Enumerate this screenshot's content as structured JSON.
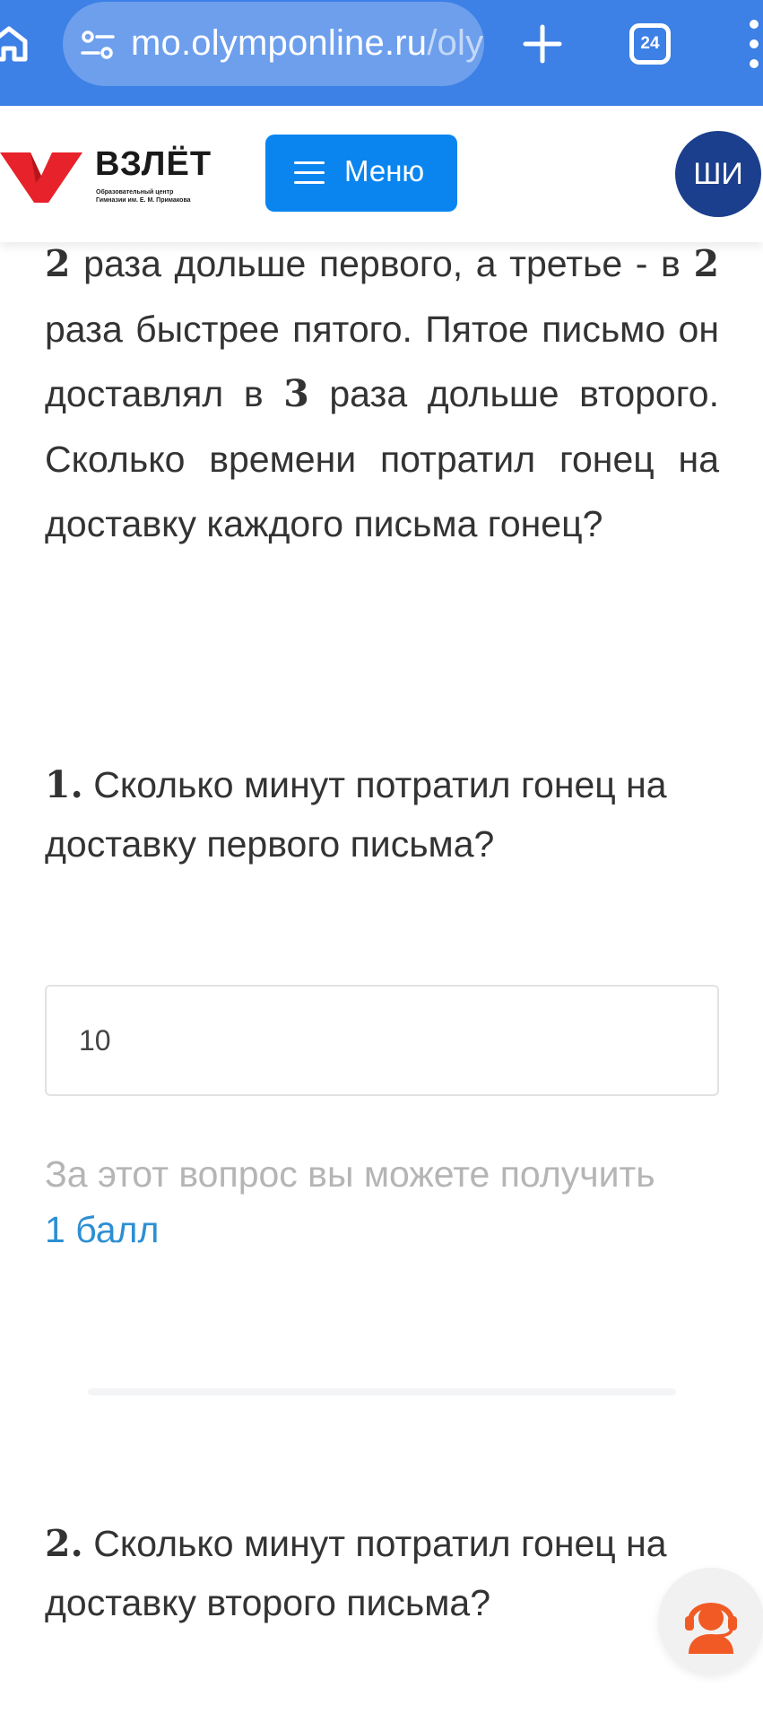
{
  "browser": {
    "url_host": "mo.olymponline.ru",
    "url_path": "/oly",
    "tab_count": "24"
  },
  "header": {
    "logo_title": "ВЗЛЁТ",
    "logo_subtitle_1": "Образовательный центр",
    "logo_subtitle_2": "Гимназии им. Е. М. Примакова",
    "menu_label": "Меню",
    "avatar_initials": "ШИ"
  },
  "task": {
    "p1_num": "2",
    "p1_text": " раза дольше первого, а третье - в ",
    "p2_num": "2",
    "p2_text": " раза быстрее пятого. Пятое письмо он доставлял в ",
    "p3_num": "3",
    "p3_text": " раза дольше второго. Сколько времени потратил гонец на доставку каждого письма гонец?"
  },
  "questions": [
    {
      "number": "1.",
      "text": " Сколько минут потратил гонец на доставку первого письма?"
    },
    {
      "number": "2.",
      "text": " Сколько минут потратил гонец на доставку второго письма?"
    }
  ],
  "answer": {
    "value": "10"
  },
  "points": {
    "prefix": "За этот вопрос вы можете получить ",
    "link": "1 балл"
  },
  "colors": {
    "browser_bar": "#3d80e6",
    "menu_button": "#0a85f0",
    "avatar": "#1b3f8c",
    "link": "#2d8fd3",
    "logo_red": "#e8222a",
    "support_orange": "#f15a24"
  },
  "icons": [
    "home-icon",
    "tune-icon",
    "plus-icon",
    "tabs-icon",
    "kebab-icon",
    "logo-v-icon",
    "burger-icon",
    "support-icon"
  ]
}
